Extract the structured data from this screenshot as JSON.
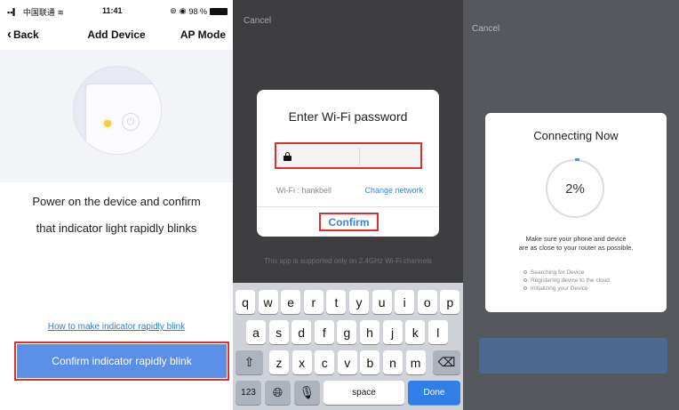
{
  "panel1": {
    "status": {
      "carrier": "中国联通",
      "time": "11:41",
      "battery": "98 %"
    },
    "nav": {
      "back": "Back",
      "title": "Add Device",
      "mode": "AP Mode"
    },
    "instruction_line1": "Power on the device and confirm",
    "instruction_line2": "that indicator light rapidly blinks",
    "help_link": "How to make indicator rapidly blink",
    "confirm_button": "Confirm indicator rapidly blink",
    "colors": {
      "accent": "#5b8fe6",
      "highlight": "#d9312b"
    }
  },
  "panel2": {
    "cancel": "Cancel",
    "dialog_title": "Enter Wi-Fi password",
    "wifi_label": "Wi-Fi : hankbell",
    "change_network": "Change network",
    "confirm": "Confirm",
    "support_note": "This app is supported only on 2.4GHz Wi-Fi channels",
    "keyboard": {
      "row1": [
        "q",
        "w",
        "e",
        "r",
        "t",
        "y",
        "u",
        "i",
        "o",
        "p"
      ],
      "row2": [
        "a",
        "s",
        "d",
        "f",
        "g",
        "h",
        "j",
        "k",
        "l"
      ],
      "row3": [
        "z",
        "x",
        "c",
        "v",
        "b",
        "n",
        "m"
      ],
      "numbers_key": "123",
      "space_key": "space",
      "done_key": "Done"
    }
  },
  "panel3": {
    "cancel": "Cancel",
    "title": "Connecting Now",
    "progress": "2%",
    "message_line1": "Make sure your phone and device",
    "message_line2": "are as close to your router as possible.",
    "steps": [
      "Searching for Device",
      "Registering device to the cloud",
      "Initializing your Device"
    ]
  }
}
